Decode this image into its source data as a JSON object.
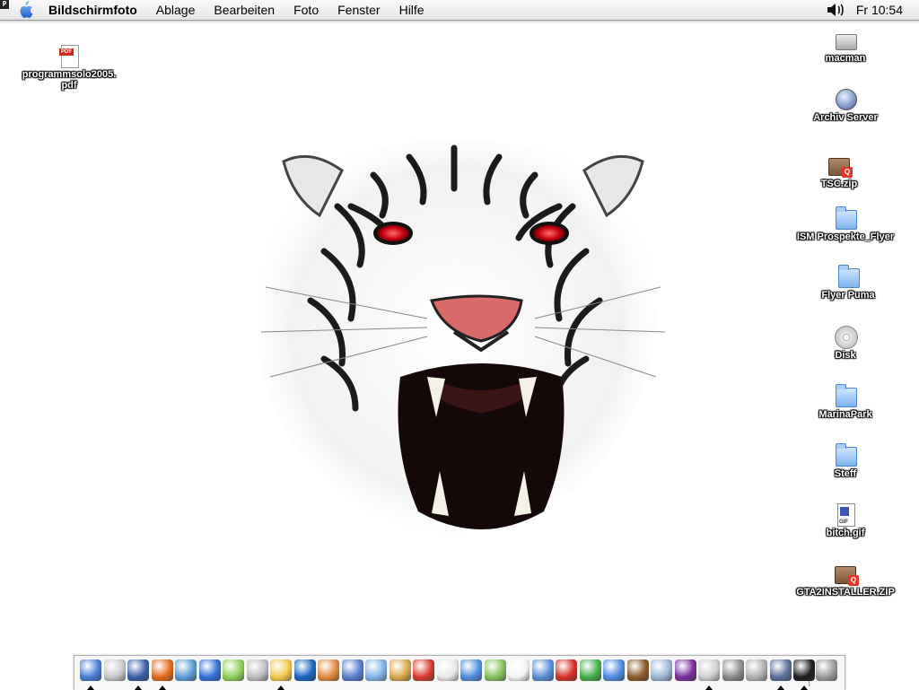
{
  "menubar": {
    "app_name": "Bildschirmfoto",
    "menus": [
      "Ablage",
      "Bearbeiten",
      "Foto",
      "Fenster",
      "Hilfe"
    ],
    "clock": "Fr 10:54"
  },
  "desktop": {
    "left_icons": [
      {
        "label": "programmsolo2005.\npdf",
        "icon": "pdf-document-icon"
      }
    ],
    "right_icons": [
      {
        "label": "macman",
        "icon": "hard-drive-icon"
      },
      {
        "label": "Archiv Server",
        "icon": "server-icon"
      },
      {
        "label": "TSC.zip",
        "icon": "zip-archive-icon"
      },
      {
        "label": "ISM Prospekte_Flyer",
        "icon": "folder-icon"
      },
      {
        "label": "Flyer Puma",
        "icon": "folder-icon"
      },
      {
        "label": "Disk",
        "icon": "disk-icon"
      },
      {
        "label": "MarinaPark",
        "icon": "folder-icon"
      },
      {
        "label": "Steff",
        "icon": "folder-icon"
      },
      {
        "label": "bitch.gif",
        "icon": "gif-document-icon"
      },
      {
        "label": "GTA2INSTALLER.ZIP",
        "icon": "zip-archive-icon"
      }
    ],
    "wallpaper": "white-tiger-roaring"
  },
  "dock": {
    "items": [
      {
        "icon": "finder-icon",
        "color": "#4a7fd6",
        "running": true
      },
      {
        "icon": "apple-system-icon",
        "color": "#c9c9c9",
        "running": false
      },
      {
        "icon": "preview-icon",
        "color": "#3b5fa8",
        "running": true
      },
      {
        "icon": "firefox-icon",
        "color": "#e66a1c",
        "running": true
      },
      {
        "icon": "safari-icon",
        "color": "#5b9bd5",
        "running": false
      },
      {
        "icon": "internet-explorer-icon",
        "color": "#2f6fd6",
        "running": false
      },
      {
        "icon": "itunes-icon",
        "color": "#8fcf5a",
        "running": false
      },
      {
        "icon": "iphoto-icon",
        "color": "#bdbdbd",
        "running": false
      },
      {
        "icon": "photo-app-icon",
        "color": "#f2c94c",
        "running": true
      },
      {
        "icon": "quicktime-icon",
        "color": "#1a66c2",
        "running": false
      },
      {
        "icon": "portrait-app-icon",
        "color": "#e0893d",
        "running": false
      },
      {
        "icon": "dreamweaver-icon",
        "color": "#5a7dd0",
        "running": false
      },
      {
        "icon": "fireworks-icon",
        "color": "#7fb3e6",
        "running": false
      },
      {
        "icon": "stamp-app-icon",
        "color": "#d8a74a",
        "running": false
      },
      {
        "icon": "acrobat-icon",
        "color": "#d63b2f",
        "running": false
      },
      {
        "icon": "acrobat-reader-icon",
        "color": "#e9e9e9",
        "running": false
      },
      {
        "icon": "word-icon",
        "color": "#4f8fe0",
        "running": false
      },
      {
        "icon": "map-app-icon",
        "color": "#86c15b",
        "running": false
      },
      {
        "icon": "ical-icon",
        "color": "#f4f4f4",
        "running": false
      },
      {
        "icon": "chat-icon",
        "color": "#5b8fd8",
        "running": false
      },
      {
        "icon": "aim-icon",
        "color": "#d6302a",
        "running": false
      },
      {
        "icon": "icq-icon",
        "color": "#43b04a",
        "running": false
      },
      {
        "icon": "bluetooth-app-icon",
        "color": "#4f8be3",
        "running": false
      },
      {
        "icon": "game-icon",
        "color": "#8a5a2b",
        "running": false
      },
      {
        "icon": "network-icon",
        "color": "#9db6d8",
        "running": false
      },
      {
        "icon": "orb-app-icon",
        "color": "#7a2f9e",
        "running": false
      },
      {
        "icon": "scissors-icon",
        "color": "#cfcfcf",
        "running": true
      },
      {
        "icon": "box-app-icon",
        "color": "#8c8c8c",
        "running": false
      },
      {
        "icon": "printer-icon",
        "color": "#b0b0b0",
        "running": false
      },
      {
        "icon": "xcode-icon",
        "color": "#5b6f9a",
        "running": true
      },
      {
        "icon": "terminal-icon",
        "color": "#1e1e1e",
        "running": true
      },
      {
        "icon": "trash-icon",
        "color": "#9a9a9a",
        "running": false
      }
    ]
  }
}
